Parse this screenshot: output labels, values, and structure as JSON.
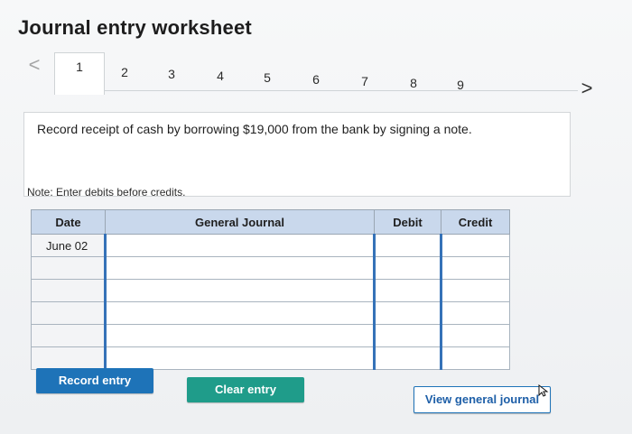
{
  "title": "Journal entry worksheet",
  "nav": {
    "prev": "<",
    "next": ">"
  },
  "tabs": [
    {
      "label": "1"
    },
    {
      "label": "2"
    },
    {
      "label": "3"
    },
    {
      "label": "4"
    },
    {
      "label": "5"
    },
    {
      "label": "6"
    },
    {
      "label": "7"
    },
    {
      "label": "8"
    },
    {
      "label": "9"
    }
  ],
  "prompt": "Record receipt of cash by borrowing $19,000 from the bank by signing a note.",
  "note": "Note: Enter debits before credits.",
  "journal": {
    "headers": {
      "date": "Date",
      "general_journal": "General Journal",
      "debit": "Debit",
      "credit": "Credit"
    },
    "rows": [
      {
        "date": "June 02"
      }
    ]
  },
  "buttons": {
    "record": "Record entry",
    "clear": "Clear entry",
    "view": "View general journal"
  }
}
